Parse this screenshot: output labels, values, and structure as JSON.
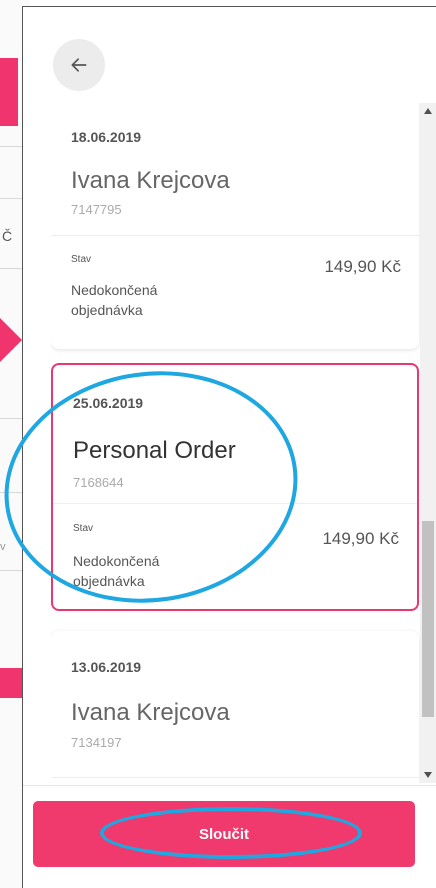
{
  "background": {
    "fragment_char": "Č",
    "fragment_char2": "v"
  },
  "panel": {
    "back_icon": "arrow-left-icon",
    "orders": [
      {
        "date": "18.06.2019",
        "name": "Ivana Krejcova",
        "number": "7147795",
        "stav_label": "Stav",
        "price": "149,90 Kč",
        "status": "Nedokončená objednávka",
        "selected": false
      },
      {
        "date": "25.06.2019",
        "name": "Personal Order",
        "number": "7168644",
        "stav_label": "Stav",
        "price": "149,90 Kč",
        "status": "Nedokončená objednávka",
        "selected": true
      },
      {
        "date": "13.06.2019",
        "name": "Ivana Krejcova",
        "number": "7134197",
        "stav_label": "",
        "price": "",
        "status": "",
        "selected": false
      }
    ],
    "merge_button_label": "Sloučit"
  },
  "colors": {
    "accent": "#f03a6e",
    "annotation": "#1ea7e1",
    "scroll_thumb": "#c1c1c1"
  }
}
